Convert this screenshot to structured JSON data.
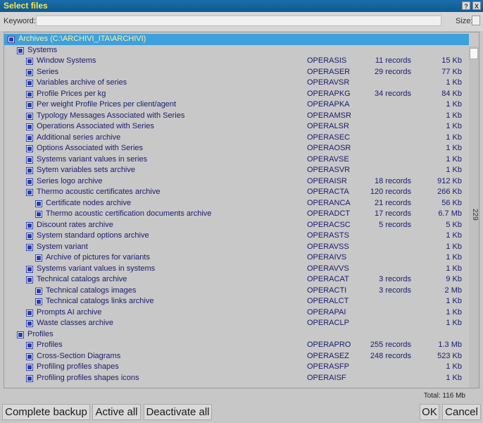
{
  "window": {
    "title": "Select files",
    "help_label": "?",
    "close_label": "X"
  },
  "toolbar": {
    "keyword_label": "Keyword:",
    "keyword_value": "",
    "size_label": "Size:"
  },
  "tree": {
    "root": {
      "label": "Archives (C:\\ARCHIVI_ITA\\ARCHIVI)"
    },
    "groups": [
      {
        "label": "Systems",
        "items": [
          {
            "name": "Window Systems",
            "code": "OPERASIS",
            "records": "11 records",
            "size": "15 Kb",
            "level": 1
          },
          {
            "name": "Series",
            "code": "OPERASER",
            "records": "29 records",
            "size": "77 Kb",
            "level": 1
          },
          {
            "name": "Variables archive of series",
            "code": "OPERAVSR",
            "records": "",
            "size": "1 Kb",
            "level": 1
          },
          {
            "name": "Profile Prices per kg",
            "code": "OPERAPKG",
            "records": "34 records",
            "size": "84 Kb",
            "level": 1
          },
          {
            "name": "Per weight Profile Prices per client/agent",
            "code": "OPERAPKA",
            "records": "",
            "size": "1 Kb",
            "level": 1
          },
          {
            "name": "Typology Messages Associated with Series",
            "code": "OPERAMSR",
            "records": "",
            "size": "1 Kb",
            "level": 1
          },
          {
            "name": "Operations Associated with Series",
            "code": "OPERALSR",
            "records": "",
            "size": "1 Kb",
            "level": 1
          },
          {
            "name": "Additional series archive",
            "code": "OPERASEC",
            "records": "",
            "size": "1 Kb",
            "level": 1
          },
          {
            "name": "Options Associated with Series",
            "code": "OPERAOSR",
            "records": "",
            "size": "1 Kb",
            "level": 1
          },
          {
            "name": "Systems variant values in series",
            "code": "OPERAVSE",
            "records": "",
            "size": "1 Kb",
            "level": 1
          },
          {
            "name": "Sytem variables sets archive",
            "code": "OPERASVR",
            "records": "",
            "size": "1 Kb",
            "level": 1
          },
          {
            "name": "Series logo archive",
            "code": "OPERAISR",
            "records": "18 records",
            "size": "912 Kb",
            "level": 1
          },
          {
            "name": "Thermo acoustic certificates archive",
            "code": "OPERACTA",
            "records": "120 records",
            "size": "266 Kb",
            "level": 1
          },
          {
            "name": "Certificate nodes archive",
            "code": "OPERANCA",
            "records": "21 records",
            "size": "56 Kb",
            "level": 2
          },
          {
            "name": "Thermo acoustic certification documents archive",
            "code": "OPERADCT",
            "records": "17 records",
            "size": "6.7 Mb",
            "level": 2
          },
          {
            "name": "Discount rates archive",
            "code": "OPERACSC",
            "records": "5 records",
            "size": "5 Kb",
            "level": 1
          },
          {
            "name": "System standard options archive",
            "code": "OPERASTS",
            "records": "",
            "size": "1 Kb",
            "level": 1
          },
          {
            "name": "System variant",
            "code": "OPERAVSS",
            "records": "",
            "size": "1 Kb",
            "level": 1
          },
          {
            "name": "Archive of pictures for variants",
            "code": "OPERAIVS",
            "records": "",
            "size": "1 Kb",
            "level": 2
          },
          {
            "name": "Systems variant values in systems",
            "code": "OPERAVVS",
            "records": "",
            "size": "1 Kb",
            "level": 1
          },
          {
            "name": "Technical catalogs archive",
            "code": "OPERACAT",
            "records": "3 records",
            "size": "9 Kb",
            "level": 1
          },
          {
            "name": "Technical catalogs images",
            "code": "OPERACTI",
            "records": "3 records",
            "size": "2 Mb",
            "level": 2
          },
          {
            "name": "Technical catalogs links archive",
            "code": "OPERALCT",
            "records": "",
            "size": "1 Kb",
            "level": 2
          },
          {
            "name": "Prompts AI archive",
            "code": "OPERAPAI",
            "records": "",
            "size": "1 Kb",
            "level": 1
          },
          {
            "name": "Waste classes archive",
            "code": "OPERACLP",
            "records": "",
            "size": "1 Kb",
            "level": 1
          }
        ]
      },
      {
        "label": "Profiles",
        "items": [
          {
            "name": "Profiles",
            "code": "OPERAPRO",
            "records": "255 records",
            "size": "1.3 Mb",
            "level": 1
          },
          {
            "name": "Cross-Section Diagrams",
            "code": "OPERASEZ",
            "records": "248 records",
            "size": "523 Kb",
            "level": 1
          },
          {
            "name": "Profiling profiles shapes",
            "code": "OPERASFP",
            "records": "",
            "size": "1 Kb",
            "level": 1
          },
          {
            "name": "Profiling profiles shapes icons",
            "code": "OPERAISF",
            "records": "",
            "size": "1 Kb",
            "level": 1
          }
        ]
      }
    ]
  },
  "scroll_count": "229",
  "total": "Total: 116 Mb",
  "buttons": {
    "complete_backup": "Complete backup",
    "active_all": "Active all",
    "deactivate_all": "Deactivate all",
    "ok": "OK",
    "cancel": "Cancel"
  },
  "colors": {
    "title_bar": "#1565a0",
    "title_text": "#ffe54a",
    "selected_row": "#3ea0dd",
    "item_text": "#1b1b6e",
    "checkbox": "#2a3da8",
    "background": "#c7c7c7"
  }
}
